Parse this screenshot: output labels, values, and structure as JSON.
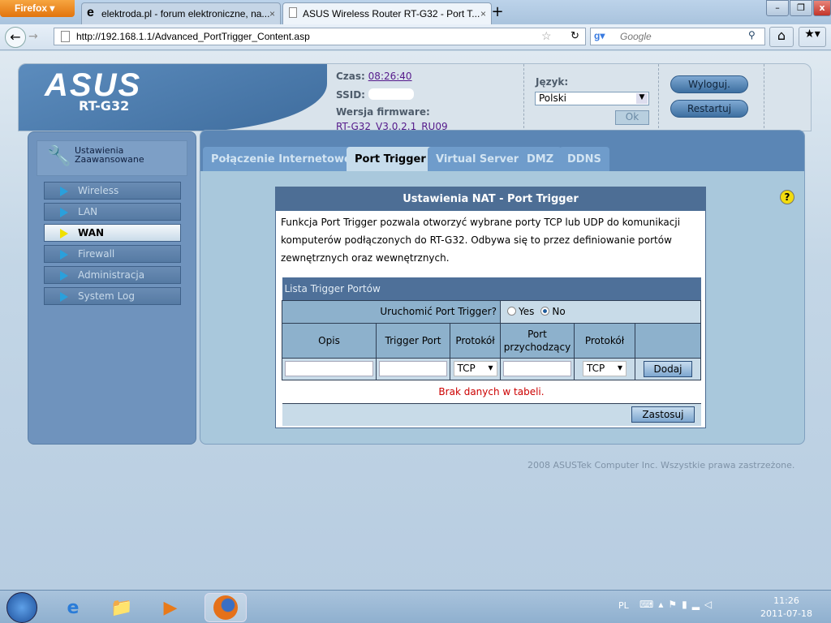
{
  "browser": {
    "menu_button": "Firefox",
    "tabs": [
      {
        "title": "elektroda.pl - forum elektroniczne, na...",
        "active": false
      },
      {
        "title": "ASUS Wireless Router RT-G32 - Port T...",
        "active": true
      }
    ],
    "url": "http://192.168.1.1/Advanced_PortTrigger_Content.asp",
    "search_placeholder": "Google"
  },
  "router": {
    "logo": "ASUS",
    "model": "RT-G32",
    "time_label": "Czas:",
    "time": "08:26:40",
    "ssid_label": "SSID:",
    "firmware_label": "Wersja firmware:",
    "firmware": "RT-G32_V3.0.2.1_RU09",
    "language_label": "Język:",
    "language": "Polski",
    "ok": "Ok",
    "logout": "Wyloguj.",
    "restart": "Restartuj"
  },
  "sidebar": {
    "title_line1": "Ustawienia",
    "title_line2": "Zaawansowane",
    "items": [
      {
        "label": "Wireless"
      },
      {
        "label": "LAN"
      },
      {
        "label": "WAN",
        "active": true
      },
      {
        "label": "Firewall"
      },
      {
        "label": "Administracja"
      },
      {
        "label": "System Log"
      }
    ]
  },
  "tabs": [
    {
      "label": "Połączenie Internetowe"
    },
    {
      "label": "Port Trigger",
      "active": true
    },
    {
      "label": "Virtual Server"
    },
    {
      "label": "DMZ"
    },
    {
      "label": "DDNS"
    }
  ],
  "panel": {
    "title": "Ustawienia NAT - Port Trigger",
    "description": "Funkcja Port Trigger pozwala otworzyć wybrane porty TCP lub UDP do komunikacji komputerów podłączonych do RT-G32. Odbywa się to przez definiowanie portów zewnętrznych oraz wewnętrznych.",
    "list_title": "Lista Trigger Portów",
    "enable_label": "Uruchomić Port Trigger?",
    "yes": "Yes",
    "no": "No",
    "enabled": "No",
    "columns": [
      "Opis",
      "Trigger Port",
      "Protokół",
      "Port przychodzący",
      "Protokół"
    ],
    "protocol1": "TCP",
    "protocol2": "TCP",
    "add": "Dodaj",
    "empty": "Brak danych w tabeli.",
    "apply": "Zastosuj"
  },
  "footer": "2008 ASUSTek Computer Inc. Wszystkie prawa zastrzeżone.",
  "taskbar": {
    "lang": "PL",
    "time": "11:26",
    "date": "2011-07-18"
  },
  "colors": {
    "accent": "#5b86b5",
    "empty_text": "#cc0000"
  }
}
